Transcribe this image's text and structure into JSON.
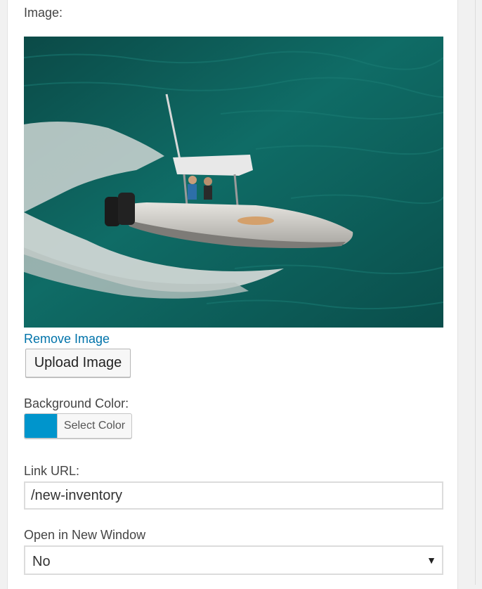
{
  "image_field": {
    "label": "Image:",
    "preview_icon": "boat-photo",
    "remove_label": "Remove Image",
    "upload_label": "Upload Image"
  },
  "background_color": {
    "label": "Background Color:",
    "button_label": "Select Color",
    "value": "#0095cc"
  },
  "link_url": {
    "label": "Link URL:",
    "value": "/new-inventory"
  },
  "new_window": {
    "label": "Open in New Window",
    "selected": "No",
    "arrow_icon": "triangle-down-icon"
  }
}
